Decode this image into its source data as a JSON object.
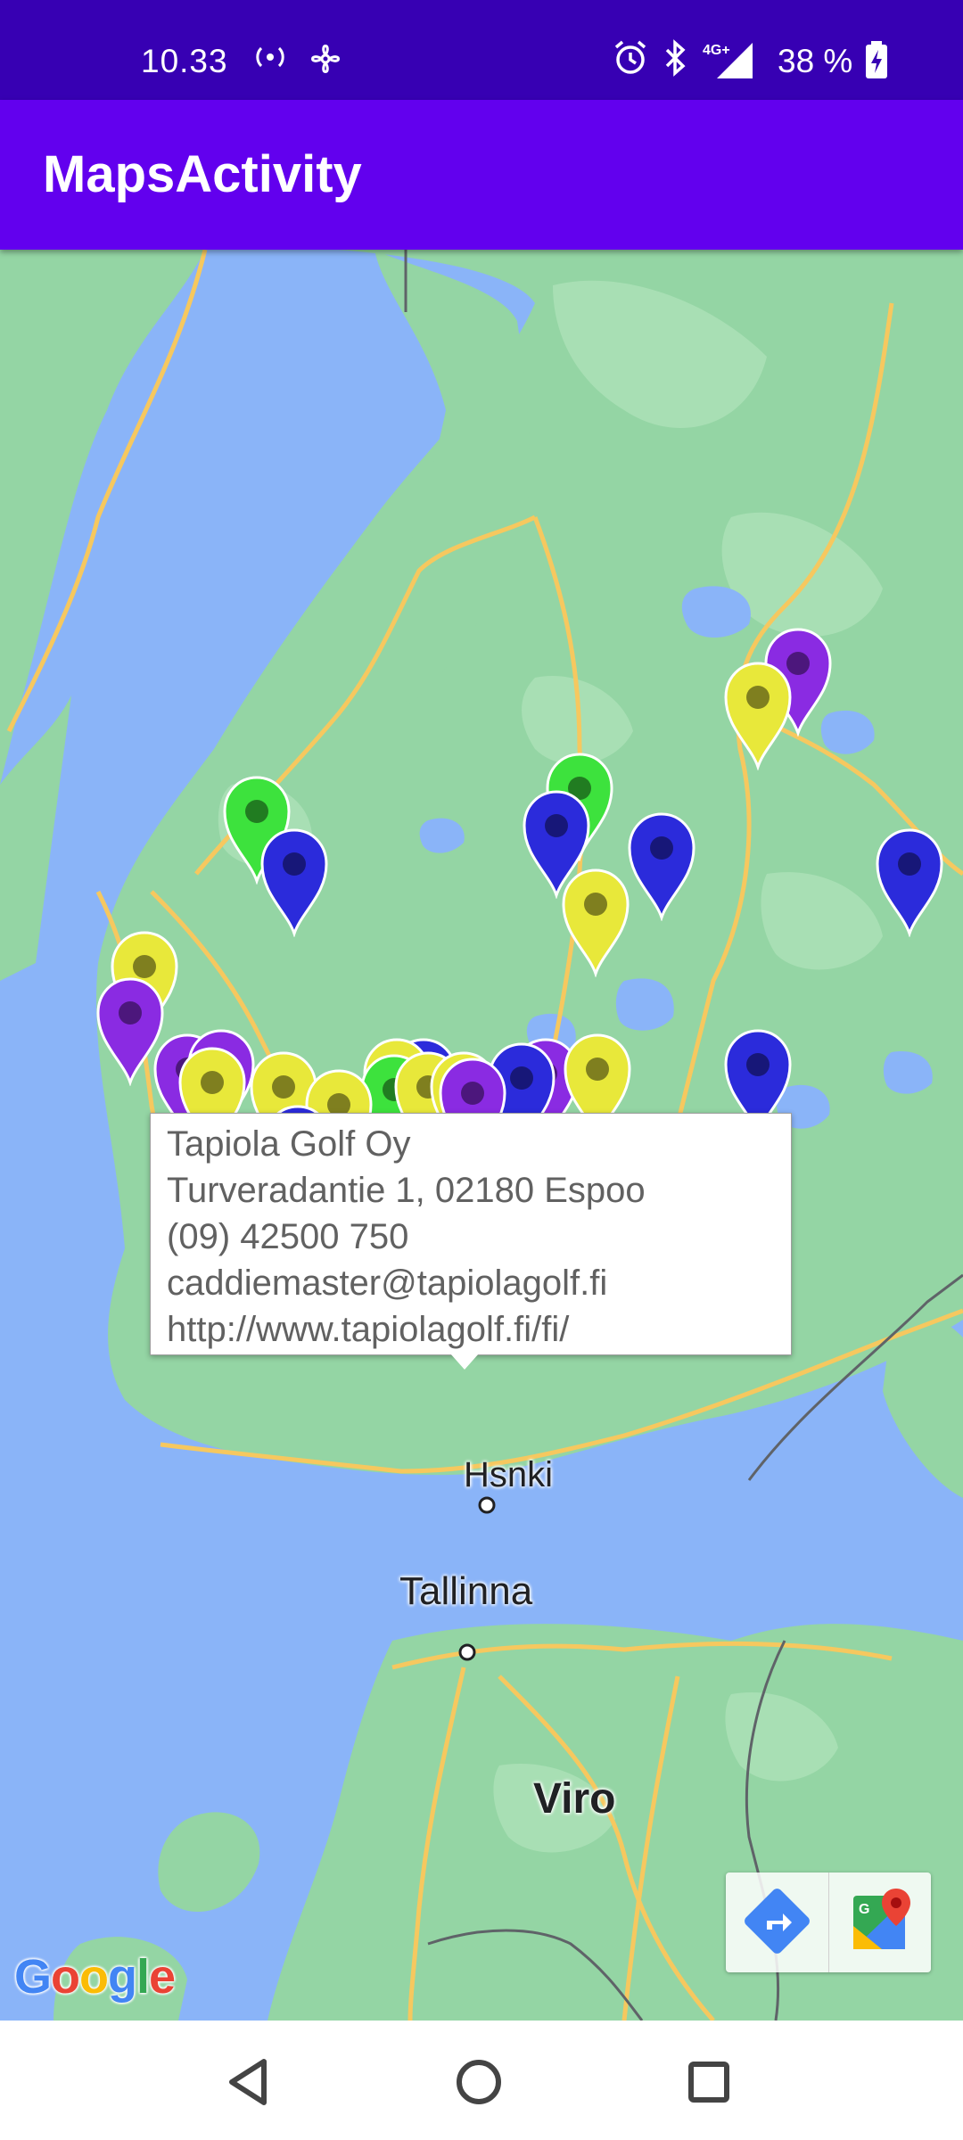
{
  "status_bar": {
    "time": "10.33",
    "battery": "38 %",
    "network": "4G+",
    "icons": [
      "hotspot-icon",
      "fan-icon",
      "alarm-icon",
      "bluetooth-icon",
      "signal-icon",
      "battery-charging-icon"
    ]
  },
  "app_bar": {
    "title": "MapsActivity"
  },
  "map": {
    "labels": {
      "tallinna": "Tallinna",
      "viro": "Viro",
      "helsinki": "Hsnki"
    },
    "pin_colors": {
      "purple": "#8a2be2",
      "yellow": "#e8e83a",
      "green": "#3de23d",
      "blue": "#2b2bdb"
    },
    "logo": "Google"
  },
  "info_window": {
    "name": "Tapiola Golf Oy",
    "address": "Turveradantie 1, 02180 Espoo",
    "phone": "(09) 42500 750",
    "email": "caddiemaster@tapiolagolf.fi",
    "url": "http://www.tapiolagolf.fi/fi/"
  },
  "toolbar": {
    "buttons": [
      "directions-icon",
      "google-maps-icon"
    ]
  },
  "nav_bar": {
    "buttons": [
      "back-icon",
      "home-icon",
      "recents-icon"
    ]
  }
}
